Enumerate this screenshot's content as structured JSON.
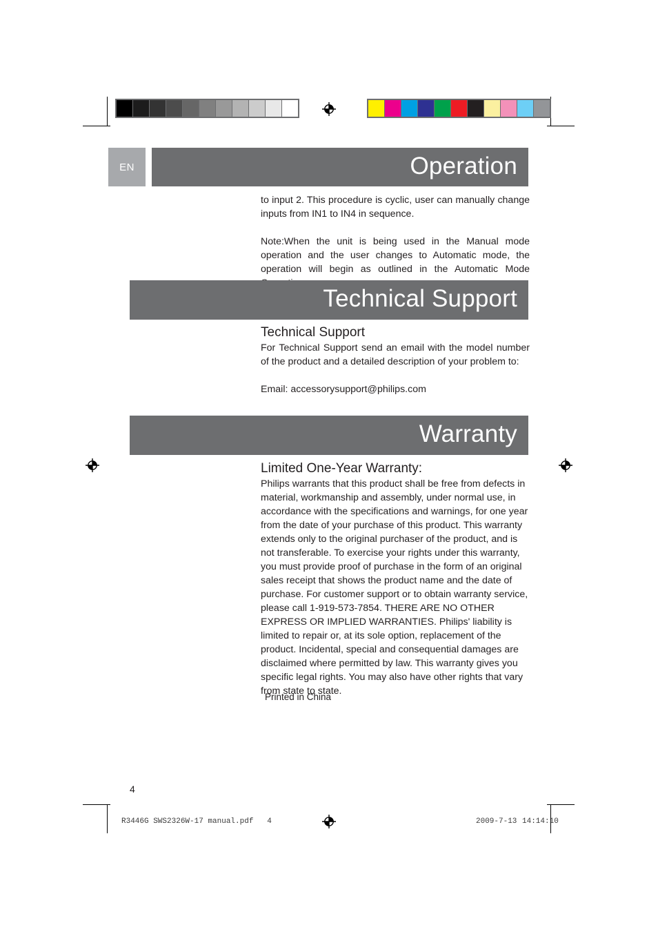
{
  "document": {
    "language_badge": "EN",
    "page_number": "4"
  },
  "sections": [
    {
      "band_title": "Operation",
      "paragraphs": [
        "to input 2. This procedure is cyclic, user can manually change inputs from IN1 to IN4 in sequence.",
        "Note:When the unit is being used in the Manual mode operation and the user changes to Automatic mode, the operation will begin as outlined in the Automatic Mode Operation."
      ]
    },
    {
      "band_title": "Technical Support",
      "subheading": "Technical Support",
      "paragraphs": [
        "For Technical Support send an email with the model number of the product and a detailed description of your problem to:",
        "Email: accessorysupport@philips.com"
      ]
    },
    {
      "band_title": "Warranty",
      "subheading": "Limited One-Year Warranty:",
      "paragraphs": [
        "Philips warrants that this product shall be free from defects in material, workmanship and assembly, under normal use, in accordance with the specifications and warnings, for one year from the date of your purchase of this product. This warranty extends only to the original purchaser of the product, and is not transferable. To exercise your rights under this warranty, you must provide proof of purchase in the form of an original sales receipt that shows the product name and the date of purchase. For customer support or to obtain warranty service, please call 1-919-573-7854. THERE ARE NO OTHER EXPRESS OR IMPLIED WARRANTIES. Philips' liability is limited to repair or, at its sole option, replacement of the product. Incidental, special and consequential damages are disclaimed where permitted by law. This warranty gives you specific legal rights. You may also have other rights that vary from state to state."
      ]
    }
  ],
  "colophon": {
    "printed_in": "Printed in China"
  },
  "print_footer": {
    "filename_line": "R3446G SWS2326W-17 manual.pdf   4",
    "date": "2009-7-13",
    "time": "14:14:10"
  },
  "print_marks": {
    "grayscale_wedge": [
      "#000000",
      "#1c1c1c",
      "#333333",
      "#4c4c4c",
      "#666666",
      "#808080",
      "#999999",
      "#b3b3b3",
      "#cccccc",
      "#e8e8e8",
      "#ffffff"
    ],
    "color_bar": [
      "#fff000",
      "#ec008c",
      "#00a0e3",
      "#2e3192",
      "#00a14b",
      "#ed1c24",
      "#231f20",
      "#fbf0a0",
      "#f391b9",
      "#6dcff6",
      "#939598"
    ],
    "registration_icon": "registration-target-icon"
  }
}
